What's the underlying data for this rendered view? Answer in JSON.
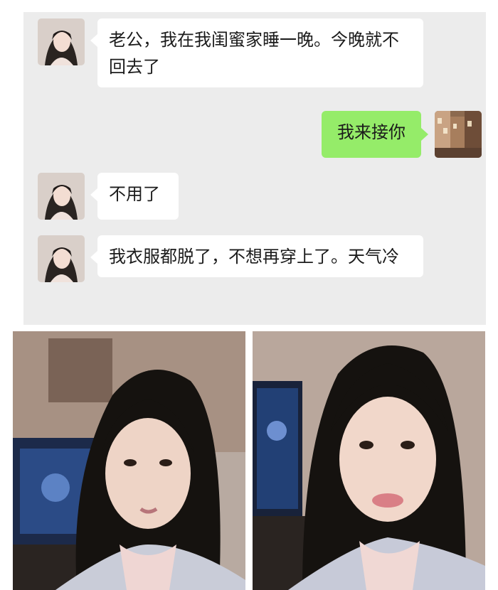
{
  "chat": {
    "messages": [
      {
        "sender": "contact",
        "text": "老公，我在我闺蜜家睡一晚。今晚就不回去了"
      },
      {
        "sender": "me",
        "text": "我来接你"
      },
      {
        "sender": "contact",
        "text": "不用了"
      },
      {
        "sender": "contact",
        "text": "我衣服都脱了，不想再穿上了。天气冷"
      }
    ]
  },
  "photos": [
    {
      "description": "selfie-left"
    },
    {
      "description": "selfie-right"
    }
  ],
  "colors": {
    "chat_background": "#ececec",
    "my_bubble": "#95ec69",
    "contact_bubble": "#ffffff"
  }
}
